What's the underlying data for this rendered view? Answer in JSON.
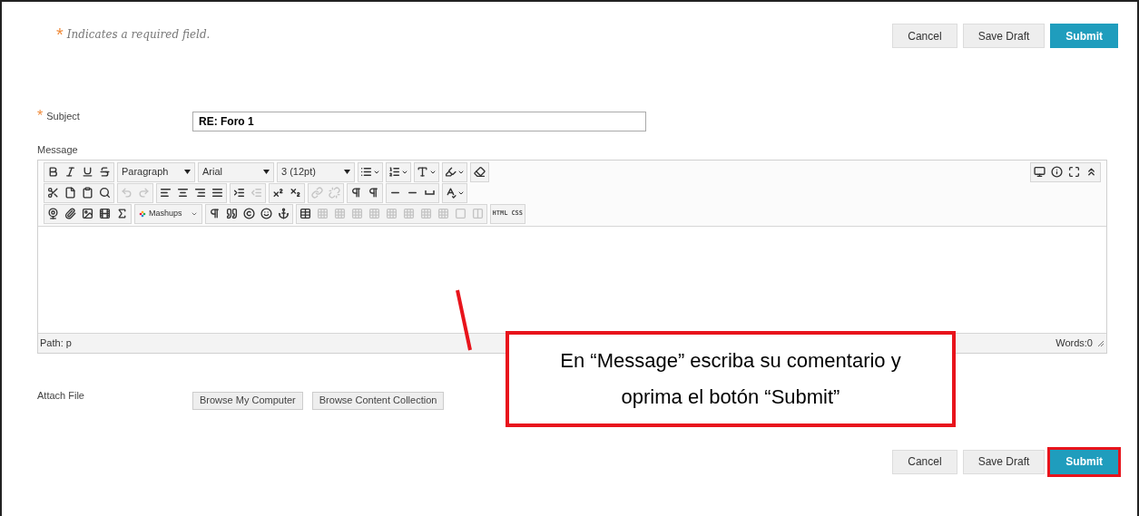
{
  "required_note": {
    "mark": "*",
    "text": "Indicates a required field."
  },
  "top_buttons": [
    {
      "label": "Cancel",
      "kind": "plain",
      "highlighted": false
    },
    {
      "label": "Save Draft",
      "kind": "plain",
      "highlighted": false
    },
    {
      "label": "Submit",
      "kind": "primary",
      "highlighted": false
    }
  ],
  "subject": {
    "mark": "*",
    "label": "Subject",
    "value": "RE: Foro 1"
  },
  "message": {
    "label": "Message",
    "toolbar_rows": [
      [
        [
          {
            "kind": "icon",
            "disabled": false
          },
          {
            "kind": "icon",
            "disabled": false
          },
          {
            "kind": "icon",
            "disabled": false
          },
          {
            "kind": "icon",
            "disabled": false
          }
        ],
        [
          {
            "kind": "select",
            "value": "Paragraph"
          }
        ],
        [
          {
            "kind": "select",
            "value": "Arial"
          }
        ],
        [
          {
            "kind": "select",
            "value": "3 (12pt)"
          }
        ],
        [
          {
            "kind": "split",
            "disabled": false
          }
        ],
        [
          {
            "kind": "split",
            "disabled": false
          }
        ],
        [
          {
            "kind": "split",
            "disabled": false
          }
        ],
        [
          {
            "kind": "split",
            "disabled": false
          }
        ],
        [
          {
            "kind": "icon",
            "disabled": false
          }
        ]
      ],
      [
        [
          {
            "kind": "icon",
            "disabled": false
          },
          {
            "kind": "icon",
            "disabled": false
          },
          {
            "kind": "icon",
            "disabled": false
          },
          {
            "kind": "icon",
            "disabled": false
          }
        ],
        [
          {
            "kind": "icon",
            "disabled": true
          },
          {
            "kind": "icon",
            "disabled": true
          }
        ],
        [
          {
            "kind": "icon",
            "disabled": false
          },
          {
            "kind": "icon",
            "disabled": false
          },
          {
            "kind": "icon",
            "disabled": false
          },
          {
            "kind": "icon",
            "disabled": false
          }
        ],
        [
          {
            "kind": "icon",
            "disabled": false
          },
          {
            "kind": "icon",
            "disabled": true
          }
        ],
        [
          {
            "kind": "icon",
            "disabled": false
          },
          {
            "kind": "icon",
            "disabled": false
          }
        ],
        [
          {
            "kind": "icon",
            "disabled": true
          },
          {
            "kind": "icon",
            "disabled": true
          }
        ],
        [
          {
            "kind": "icon",
            "disabled": false
          },
          {
            "kind": "icon",
            "disabled": false
          }
        ],
        [
          {
            "kind": "icon",
            "disabled": false
          },
          {
            "kind": "icon",
            "disabled": false
          },
          {
            "kind": "icon",
            "disabled": false
          }
        ],
        [
          {
            "kind": "split",
            "disabled": false
          }
        ]
      ],
      [
        [
          {
            "kind": "icon",
            "disabled": false
          },
          {
            "kind": "icon",
            "disabled": false
          },
          {
            "kind": "icon",
            "disabled": false
          },
          {
            "kind": "icon",
            "disabled": false
          },
          {
            "kind": "icon",
            "disabled": false
          }
        ],
        [
          {
            "kind": "mashups",
            "text": "Mashups"
          }
        ],
        [
          {
            "kind": "icon",
            "disabled": false
          },
          {
            "kind": "icon",
            "disabled": false
          },
          {
            "kind": "icon",
            "disabled": false
          },
          {
            "kind": "icon",
            "disabled": false
          },
          {
            "kind": "icon",
            "disabled": false
          }
        ],
        [
          {
            "kind": "icon",
            "disabled": false
          },
          {
            "kind": "icon",
            "disabled": true
          },
          {
            "kind": "icon",
            "disabled": true
          },
          {
            "kind": "icon",
            "disabled": true
          },
          {
            "kind": "icon",
            "disabled": true
          },
          {
            "kind": "icon",
            "disabled": true
          },
          {
            "kind": "icon",
            "disabled": true
          },
          {
            "kind": "icon",
            "disabled": true
          },
          {
            "kind": "icon",
            "disabled": true
          },
          {
            "kind": "icon",
            "disabled": true
          },
          {
            "kind": "icon",
            "disabled": true
          }
        ],
        [
          {
            "kind": "text",
            "text": "HTML"
          },
          {
            "kind": "text",
            "text": "CSS"
          }
        ]
      ]
    ],
    "right_tools": [
      {
        "disabled": false
      },
      {
        "disabled": false
      },
      {
        "disabled": false
      },
      {
        "disabled": false
      }
    ],
    "path": "Path: p",
    "word_count": "Words:0"
  },
  "attach": {
    "label": "Attach File",
    "buttons": [
      "Browse My Computer",
      "Browse Content Collection"
    ]
  },
  "bottom_buttons": [
    {
      "label": "Cancel",
      "kind": "plain",
      "highlighted": false
    },
    {
      "label": "Save Draft",
      "kind": "plain",
      "highlighted": false
    },
    {
      "label": "Submit",
      "kind": "primary",
      "highlighted": true
    }
  ],
  "callout": {
    "text": "En “Message” escriba su comentario y oprima el botón “Submit”"
  }
}
